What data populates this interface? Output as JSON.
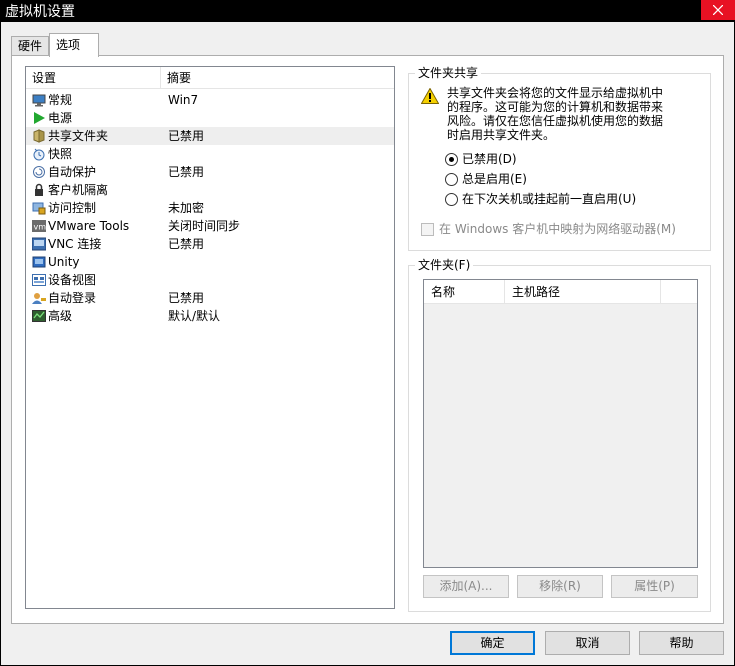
{
  "window": {
    "title": "虚拟机设置"
  },
  "tabs": [
    {
      "label": "硬件"
    },
    {
      "label": "选项"
    }
  ],
  "settings_list": {
    "headers": [
      "设置",
      "摘要"
    ],
    "rows": [
      {
        "name": "常规",
        "summary": "Win7",
        "icon": "monitor-icon"
      },
      {
        "name": "电源",
        "summary": "",
        "icon": "power-play-icon"
      },
      {
        "name": "共享文件夹",
        "summary": "已禁用",
        "icon": "shared-folder-icon"
      },
      {
        "name": "快照",
        "summary": "",
        "icon": "snapshot-icon"
      },
      {
        "name": "自动保护",
        "summary": "已禁用",
        "icon": "autoprotect-icon"
      },
      {
        "name": "客户机隔离",
        "summary": "",
        "icon": "lock-icon"
      },
      {
        "name": "访问控制",
        "summary": "未加密",
        "icon": "access-control-icon"
      },
      {
        "name": "VMware Tools",
        "summary": "关闭时间同步",
        "icon": "vmware-tools-icon"
      },
      {
        "name": "VNC 连接",
        "summary": "已禁用",
        "icon": "vnc-icon"
      },
      {
        "name": "Unity",
        "summary": "",
        "icon": "unity-icon"
      },
      {
        "name": "设备视图",
        "summary": "",
        "icon": "device-view-icon"
      },
      {
        "name": "自动登录",
        "summary": "已禁用",
        "icon": "auto-login-icon"
      },
      {
        "name": "高级",
        "summary": "默认/默认",
        "icon": "advanced-icon"
      }
    ],
    "selected_index": 2
  },
  "sharing": {
    "legend": "文件夹共享",
    "warning_lines": [
      "共享文件夹会将您的文件显示给虚拟机中",
      "的程序。这可能为您的计算机和数据带来",
      "风险。请仅在您信任虚拟机使用您的数据",
      "时启用共享文件夹。"
    ],
    "options": [
      {
        "label": "已禁用(D)",
        "checked": true
      },
      {
        "label": "总是启用(E)",
        "checked": false
      },
      {
        "label": "在下次关机或挂起前一直启用(U)",
        "checked": false
      }
    ],
    "map_drive_label": "在 Windows 客户机中映射为网络驱动器(M)"
  },
  "folders": {
    "legend": "文件夹(F)",
    "headers": [
      "名称",
      "主机路径"
    ],
    "add_label": "添加(A)...",
    "remove_label": "移除(R)",
    "properties_label": "属性(P)"
  },
  "footer": {
    "ok_label": "确定",
    "cancel_label": "取消",
    "help_label": "帮助"
  },
  "colors": {
    "close_button": "#e81123",
    "default_button_border": "#0078d7",
    "selected_row": "#eeeeee"
  }
}
